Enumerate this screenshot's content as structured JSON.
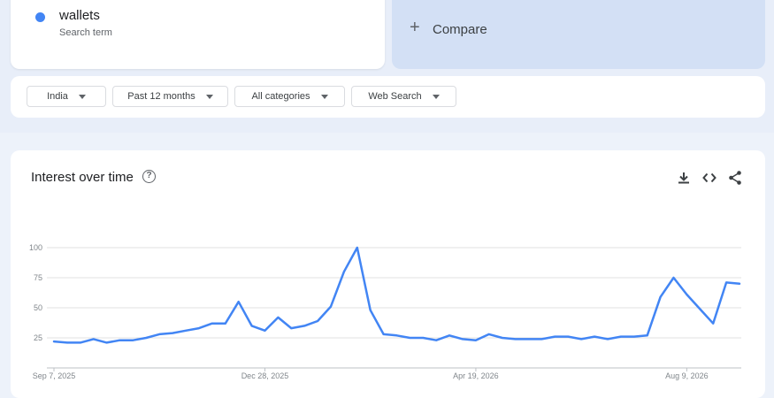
{
  "search_term": {
    "name": "wallets",
    "subtitle": "Search term",
    "color": "#4285f4"
  },
  "compare": {
    "label": "Compare",
    "icon": "plus-icon"
  },
  "filters": [
    {
      "label": "India"
    },
    {
      "label": "Past 12 months"
    },
    {
      "label": "All categories"
    },
    {
      "label": "Web Search"
    }
  ],
  "interest_over_time": {
    "title": "Interest over time",
    "icons": [
      "help-icon",
      "download-icon",
      "embed-code-icon",
      "share-icon"
    ]
  },
  "chart_data": {
    "type": "line",
    "title": "Interest over time",
    "xlabel": "",
    "ylabel": "",
    "ylim": [
      0,
      100
    ],
    "yticks": [
      25,
      50,
      75,
      100
    ],
    "xtick_labels": [
      "Sep 7, 2025",
      "Dec 28, 2025",
      "Apr 19, 2026",
      "Aug 9, 2026"
    ],
    "xtick_index": [
      0,
      16,
      32,
      48
    ],
    "grid": true,
    "color": "#4285f4",
    "series": [
      {
        "values": [
          22,
          21,
          21,
          24,
          21,
          23,
          23,
          25,
          28,
          29,
          31,
          33,
          37,
          37,
          55,
          35,
          31,
          42,
          33,
          35,
          39,
          51,
          80,
          100,
          48,
          28,
          27,
          25,
          25,
          23,
          27,
          24,
          23,
          28,
          25,
          24,
          24,
          24,
          26,
          26,
          24,
          26,
          24,
          26,
          26,
          27,
          59,
          75,
          61,
          49,
          37,
          71,
          70
        ]
      }
    ]
  }
}
